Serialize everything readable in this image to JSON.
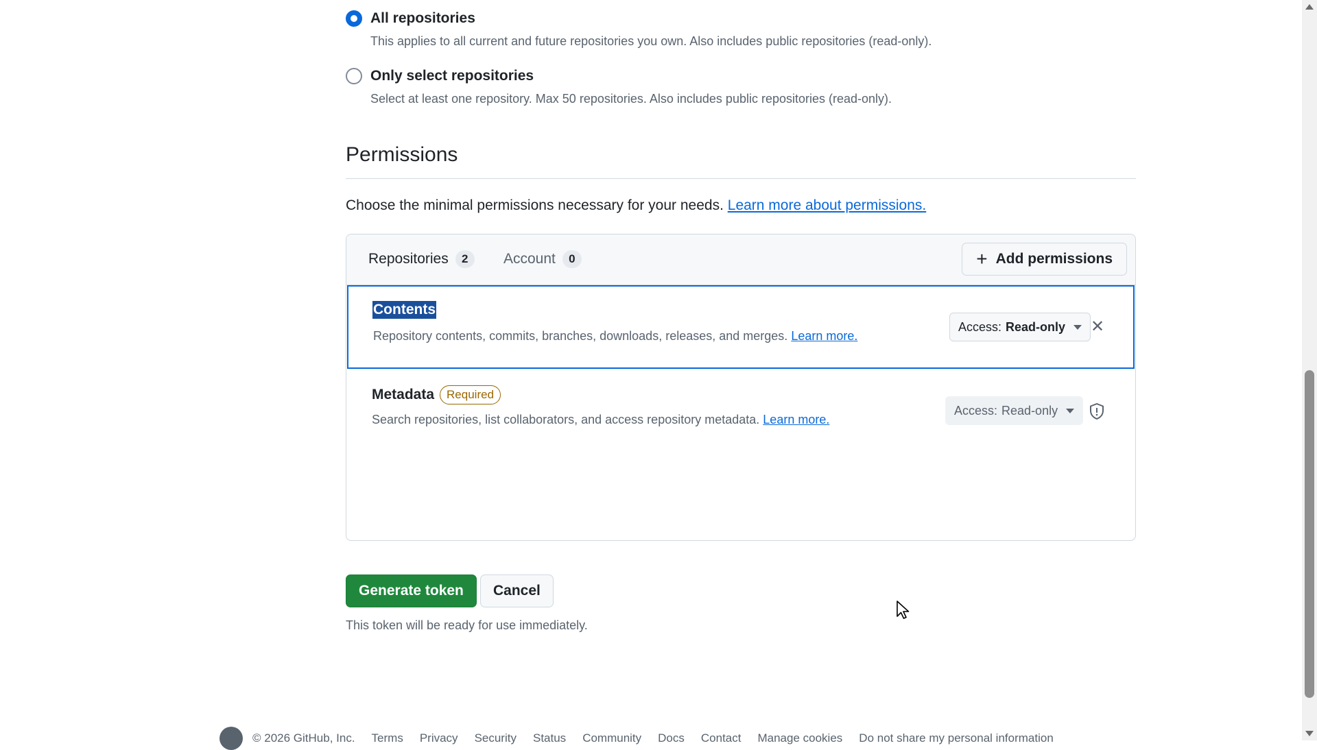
{
  "repository_access": {
    "all": {
      "label": "All repositories",
      "description": "This applies to all current and future repositories you own. Also includes public repositories (read-only).",
      "checked": true
    },
    "select": {
      "label": "Only select repositories",
      "description": "Select at least one repository. Max 50 repositories. Also includes public repositories (read-only).",
      "checked": false
    }
  },
  "permissions": {
    "title": "Permissions",
    "intro": "Choose the minimal permissions necessary for your needs.",
    "intro_link": "Learn more about permissions.",
    "tabs": [
      {
        "label": "Repositories",
        "count": "2"
      },
      {
        "label": "Account",
        "count": "0"
      }
    ],
    "add_button": "Add permissions",
    "items": [
      {
        "name": "Contents",
        "description": "Repository contents, commits, branches, downloads, releases, and merges.",
        "link": "Learn more.",
        "access_label": "Access:",
        "access_value": "Read-only"
      },
      {
        "name": "Metadata",
        "badge": "Required",
        "description": "Search repositories, list collaborators, and access repository metadata.",
        "link": "Learn more.",
        "access_label": "Access:",
        "access_value": "Read-only"
      }
    ]
  },
  "actions": {
    "generate": "Generate token",
    "cancel": "Cancel",
    "note": "This token will be ready for use immediately."
  },
  "footer": {
    "copyright": "© 2026 GitHub, Inc.",
    "links": [
      "Terms",
      "Privacy",
      "Security",
      "Status",
      "Community",
      "Docs",
      "Contact",
      "Manage cookies",
      "Do not share my personal information"
    ]
  },
  "colors": {
    "accent": "#0969da",
    "primary_button": "#1f883d",
    "required_badge": "#9a6700"
  }
}
